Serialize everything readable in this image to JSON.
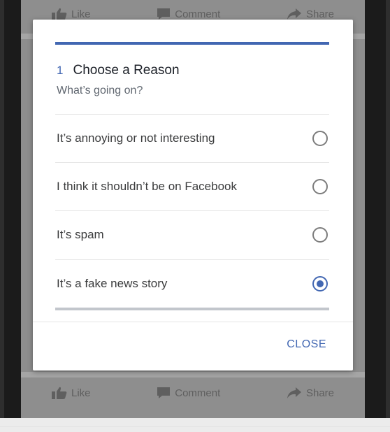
{
  "feed": {
    "actions": [
      {
        "label": "Like",
        "icon": "thumbs-up-icon"
      },
      {
        "label": "Comment",
        "icon": "comment-icon"
      },
      {
        "label": "Share",
        "icon": "share-arrow-icon"
      }
    ]
  },
  "dialog": {
    "step_number": "1",
    "title": "Choose a Reason",
    "subtitle": "What’s going on?",
    "options": [
      {
        "label": "It’s annoying or not interesting",
        "selected": false
      },
      {
        "label": "I think it shouldn’t be on Facebook",
        "selected": false
      },
      {
        "label": "It’s spam",
        "selected": false
      },
      {
        "label": "It’s a fake news story",
        "selected": true
      }
    ],
    "close_label": "CLOSE"
  },
  "colors": {
    "accent": "#4267b2",
    "overlay": "#8e8e8e"
  }
}
